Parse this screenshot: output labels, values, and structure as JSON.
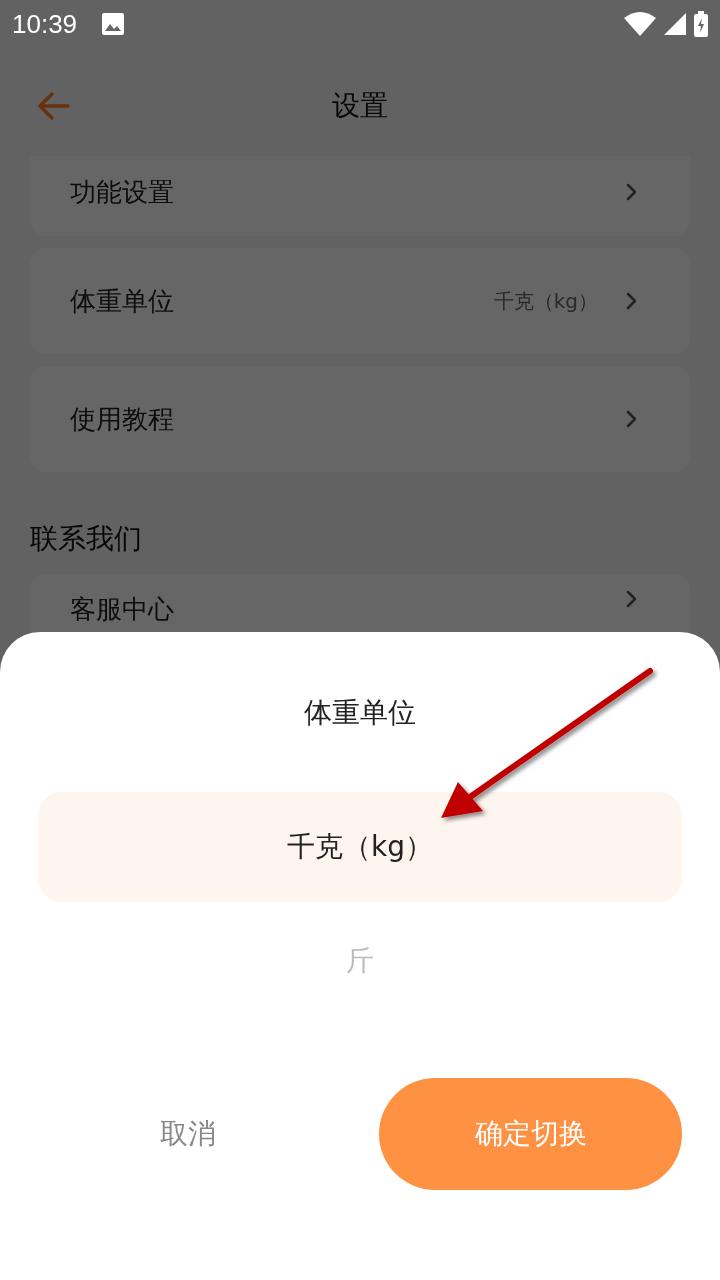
{
  "status_bar": {
    "time": "10:39"
  },
  "header": {
    "title": "设置"
  },
  "settings": [
    {
      "label": "功能设置"
    },
    {
      "label": "体重单位",
      "value": "千克（kg）"
    },
    {
      "label": "使用教程"
    }
  ],
  "contact_section": {
    "heading": "联系我们",
    "items": [
      {
        "label": "客服中心"
      }
    ]
  },
  "sheet": {
    "title": "体重单位",
    "options": [
      {
        "label": "千克（kg）",
        "selected": true
      },
      {
        "label": "斤",
        "selected": false
      }
    ],
    "cancel": "取消",
    "confirm": "确定切换"
  }
}
